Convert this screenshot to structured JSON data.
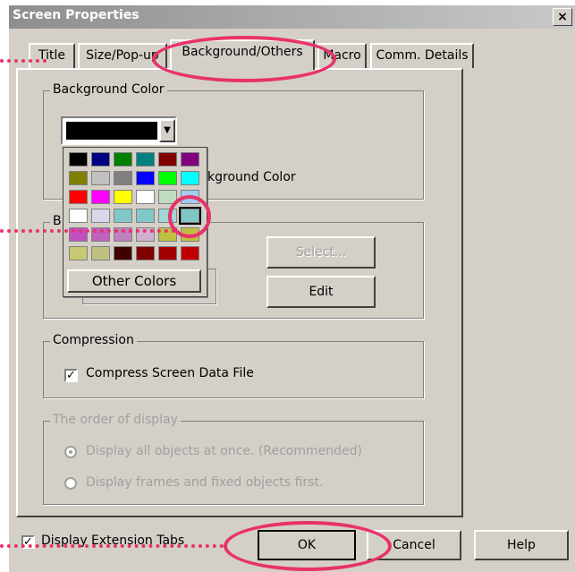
{
  "window": {
    "title": "Screen Properties",
    "close_glyph": "×"
  },
  "tabs": [
    {
      "label": "Title"
    },
    {
      "label": "Size/Pop-up"
    },
    {
      "label": "Background/Others"
    },
    {
      "label": "Macro"
    },
    {
      "label": "Comm. Details"
    }
  ],
  "background_color": {
    "group_label": "Background Color",
    "selected_color": "#000000",
    "checkbox_label_visible": "kground Color"
  },
  "bitmap_group": {
    "label_visible": "B",
    "select_label": "Select...",
    "edit_label": "Edit"
  },
  "color_palette": {
    "other_colors_label": "Other Colors",
    "rows": [
      [
        "#000000",
        "#000080",
        "#008000",
        "#008080",
        "#800000",
        "#800080"
      ],
      [
        "#808000",
        "#c0c0c0",
        "#808080",
        "#0000ff",
        "#00ff00",
        "#00ffff"
      ],
      [
        "#ff0000",
        "#ff00ff",
        "#ffff00",
        "#ffffff",
        "#c0dcc0",
        "#a6caf0"
      ],
      [
        "#ffffff",
        "#d8d8e8",
        "#80c8c8",
        "#80c8c8",
        "#a0d8d8",
        "#c8c870"
      ],
      [
        "#c050c0",
        "#c060c0",
        "#c080c0",
        "#d0b0d0",
        "#c0c040",
        "#c0c040"
      ],
      [
        "#c8c870",
        "#c0c080",
        "#400000",
        "#800000",
        "#a00000",
        "#c00000"
      ]
    ]
  },
  "compression": {
    "group_label": "Compression",
    "checkbox_label": "Compress Screen Data File",
    "checked": true
  },
  "display_order": {
    "group_label": "The order of display",
    "option1": "Display all objects at once. (Recommended)",
    "option2": "Display frames and fixed objects first."
  },
  "footer": {
    "extension_tabs_label": "Display Extension Tabs",
    "extension_tabs_checked": true,
    "ok_label": "OK",
    "cancel_label": "Cancel",
    "help_label": "Help"
  },
  "colors": {
    "highlight": "#e8326a",
    "dialog_face": "#d4d0c8"
  }
}
